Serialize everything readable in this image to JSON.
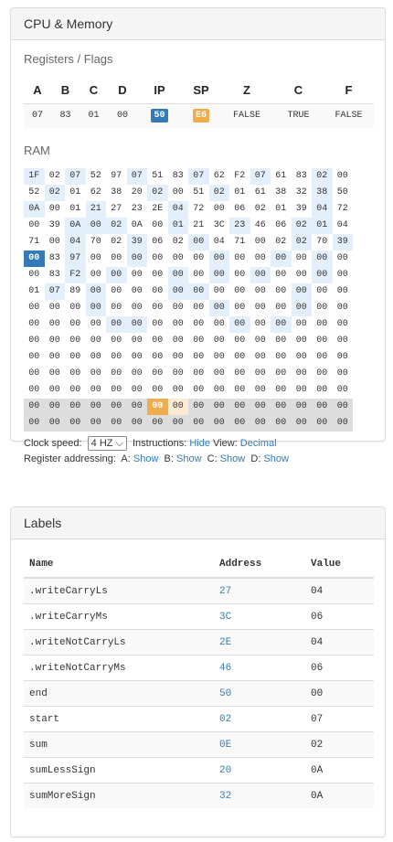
{
  "cpu_panel": {
    "title": "CPU & Memory",
    "registers_title": "Registers / Flags",
    "registers": [
      {
        "name": "A",
        "value": "07"
      },
      {
        "name": "B",
        "value": "83"
      },
      {
        "name": "C",
        "value": "01"
      },
      {
        "name": "D",
        "value": "00"
      },
      {
        "name": "IP",
        "value": "50"
      },
      {
        "name": "SP",
        "value": "E6"
      },
      {
        "name": "Z",
        "value": "FALSE"
      },
      {
        "name": "C",
        "value": "TRUE"
      },
      {
        "name": "F",
        "value": "FALSE"
      }
    ],
    "ram_title": "RAM",
    "ram_rows": [
      [
        "1F",
        "02",
        "07",
        "52",
        "97",
        "07",
        "51",
        "83",
        "07",
        "62",
        "F2",
        "07",
        "61",
        "83",
        "02",
        "00"
      ],
      [
        "52",
        "02",
        "01",
        "62",
        "38",
        "20",
        "02",
        "00",
        "51",
        "02",
        "01",
        "61",
        "38",
        "32",
        "38",
        "50"
      ],
      [
        "0A",
        "00",
        "01",
        "21",
        "27",
        "23",
        "2E",
        "04",
        "72",
        "00",
        "06",
        "02",
        "01",
        "39",
        "04",
        "72"
      ],
      [
        "00",
        "39",
        "0A",
        "00",
        "02",
        "0A",
        "00",
        "01",
        "21",
        "3C",
        "23",
        "46",
        "06",
        "02",
        "01",
        "04"
      ],
      [
        "71",
        "00",
        "04",
        "70",
        "02",
        "39",
        "06",
        "02",
        "00",
        "04",
        "71",
        "00",
        "02",
        "02",
        "70",
        "39"
      ],
      [
        "00",
        "83",
        "97",
        "00",
        "00",
        "00",
        "00",
        "00",
        "00",
        "00",
        "00",
        "00",
        "00",
        "00",
        "00",
        "00"
      ],
      [
        "00",
        "83",
        "F2",
        "00",
        "00",
        "00",
        "00",
        "00",
        "00",
        "00",
        "00",
        "00",
        "00",
        "00",
        "00",
        "00"
      ],
      [
        "01",
        "07",
        "89",
        "00",
        "00",
        "00",
        "00",
        "00",
        "00",
        "00",
        "00",
        "00",
        "00",
        "00",
        "00",
        "00"
      ],
      [
        "00",
        "00",
        "00",
        "00",
        "00",
        "00",
        "00",
        "00",
        "00",
        "00",
        "00",
        "00",
        "00",
        "00",
        "00",
        "00"
      ],
      [
        "00",
        "00",
        "00",
        "00",
        "00",
        "00",
        "00",
        "00",
        "00",
        "00",
        "00",
        "00",
        "00",
        "00",
        "00",
        "00"
      ],
      [
        "00",
        "00",
        "00",
        "00",
        "00",
        "00",
        "00",
        "00",
        "00",
        "00",
        "00",
        "00",
        "00",
        "00",
        "00",
        "00"
      ],
      [
        "00",
        "00",
        "00",
        "00",
        "00",
        "00",
        "00",
        "00",
        "00",
        "00",
        "00",
        "00",
        "00",
        "00",
        "00",
        "00"
      ],
      [
        "00",
        "00",
        "00",
        "00",
        "00",
        "00",
        "00",
        "00",
        "00",
        "00",
        "00",
        "00",
        "00",
        "00",
        "00",
        "00"
      ],
      [
        "00",
        "00",
        "00",
        "00",
        "00",
        "00",
        "00",
        "00",
        "00",
        "00",
        "00",
        "00",
        "00",
        "00",
        "00",
        "00"
      ],
      [
        "00",
        "00",
        "00",
        "00",
        "00",
        "00",
        "00",
        "00",
        "00",
        "00",
        "00",
        "00",
        "00",
        "00",
        "00",
        "00"
      ],
      [
        "00",
        "00",
        "00",
        "00",
        "00",
        "00",
        "00",
        "00",
        "00",
        "00",
        "00",
        "00",
        "00",
        "00",
        "00",
        "00"
      ]
    ],
    "ram_highlights": {
      "register_cells": [
        0,
        2,
        5,
        8,
        11,
        14,
        17,
        22,
        25,
        30,
        32,
        35,
        39,
        46,
        50,
        51,
        52,
        55,
        58,
        61,
        62,
        66,
        69,
        72,
        77,
        79,
        82,
        85,
        89,
        92,
        94,
        98,
        100,
        103,
        105,
        107,
        110,
        113,
        115,
        119,
        120,
        125,
        131,
        137,
        141,
        148,
        149,
        154,
        156
      ],
      "ip_cell": 80,
      "sp_cell": 230,
      "return_cells": [
        231
      ],
      "stack_from": 224
    },
    "clock_speed_label": "Clock speed:",
    "clock_speed_value": "4 HZ",
    "instructions_label": "Instructions:",
    "instructions_link": "Hide",
    "view_label": "View:",
    "view_link": "Decimal",
    "register_addressing_label": "Register addressing:",
    "addressing": [
      {
        "name": "A:",
        "link": "Show"
      },
      {
        "name": "B:",
        "link": "Show"
      },
      {
        "name": "C:",
        "link": "Show"
      },
      {
        "name": "D:",
        "link": "Show"
      }
    ],
    "colors": {
      "ip": "#337ab7",
      "sp": "#f0ad4e",
      "register_cell": "#e3f0fc",
      "stack": "#dddddd"
    }
  },
  "labels_panel": {
    "title": "Labels",
    "columns": [
      "Name",
      "Address",
      "Value"
    ],
    "rows": [
      {
        "name": ".writeCarryLs",
        "address": "27",
        "value": "04"
      },
      {
        "name": ".writeCarryMs",
        "address": "3C",
        "value": "06"
      },
      {
        "name": ".writeNotCarryLs",
        "address": "2E",
        "value": "04"
      },
      {
        "name": ".writeNotCarryMs",
        "address": "46",
        "value": "06"
      },
      {
        "name": "end",
        "address": "50",
        "value": "00"
      },
      {
        "name": "start",
        "address": "02",
        "value": "07"
      },
      {
        "name": "sum",
        "address": "0E",
        "value": "02"
      },
      {
        "name": "sumLessSign",
        "address": "20",
        "value": "0A"
      },
      {
        "name": "sumMoreSign",
        "address": "32",
        "value": "0A"
      }
    ]
  }
}
